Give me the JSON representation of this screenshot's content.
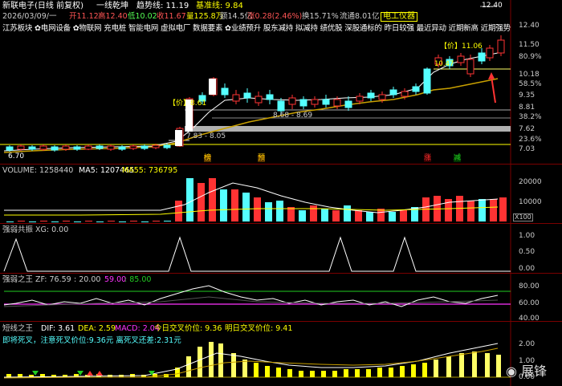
{
  "header": {
    "stock_title": "新联电子(日线 前复权)",
    "ma_label": "一线乾坤",
    "trend_label": "趋势线: 11.19",
    "base_label": "基准线: 9.84",
    "date": "2026/03/09/一",
    "open": "开11.12",
    "high": "高12.40",
    "low": "低10.02",
    "close": "收11.67",
    "volume": "量125.8万",
    "amount": "额14.5亿",
    "change": "涨0.28(2.46%)",
    "turnover": "换15.71%",
    "float_cap": "流通8.01亿",
    "industry": "电工仪器",
    "concepts": "江苏板块 ✿电网设备 ✿物联网 充电桩 智能电网 虚拟电厂 数据要素 ✿业绩预升 股东减持 拟减持 绩优股 深股通标的 昨日较强 最近异动 近期新高 近期强势"
  },
  "colors": {
    "up": "#ff3333",
    "down": "#55ffff",
    "yellow": "#ffff00",
    "white": "#ffffff",
    "gold": "#d4b000",
    "magenta": "#ff33ff",
    "green": "#22cc22",
    "label": "#cccccc"
  },
  "price_panel": {
    "axis_labels": [
      "12.40",
      "11.50",
      "80.9%",
      "10.18",
      "58.5%",
      "9.35",
      "8.81",
      "38.2%",
      "7.62",
      "23.6%",
      "7.03"
    ],
    "low_mark": "6.70",
    "chart_high_mark": "12.40",
    "price_badge": "【价】11.06",
    "small_badge": "【价】8.61",
    "level_a": "10.47",
    "level_b": "10.42",
    "range_a": "8.68 - 8.69",
    "range_b": "7.83 - 8.05",
    "signals": [
      "榜",
      "预",
      "涨",
      "减"
    ]
  },
  "volume_panel": {
    "label": "VOLUME: 1258440",
    "ma5": "MA5: 1207465",
    "ma55": "MA55: 736795",
    "axis_labels": [
      "20000",
      "10000"
    ],
    "unit": "X100"
  },
  "panel_xg": {
    "label": "强弱共振 XG: 0.00",
    "axis_labels": [
      "1.00",
      "0.50",
      "0.00"
    ]
  },
  "panel_zf": {
    "label": "强弱之王 ZF: 76.59",
    "v1": ": 20.00",
    "v2": "59.00",
    "v3": ": 85.00",
    "axis_labels": [
      "80.00",
      "60.00",
      "40.00"
    ]
  },
  "panel_macd": {
    "label": "短线之王",
    "dif": "DIF: 3.61",
    "dea": "DEA: 2.59",
    "macd": "MACD: 2.04",
    "today_cross": "今日交叉价位: 9.36",
    "tomorrow_cross": "明日交叉价位: 9.41",
    "note": "即将死叉，注意死叉价位:9.36元 离死叉还差:2.31元",
    "axis_labels": [
      "2.00",
      "1.00",
      "0.00"
    ]
  },
  "watermark": "展锋"
}
